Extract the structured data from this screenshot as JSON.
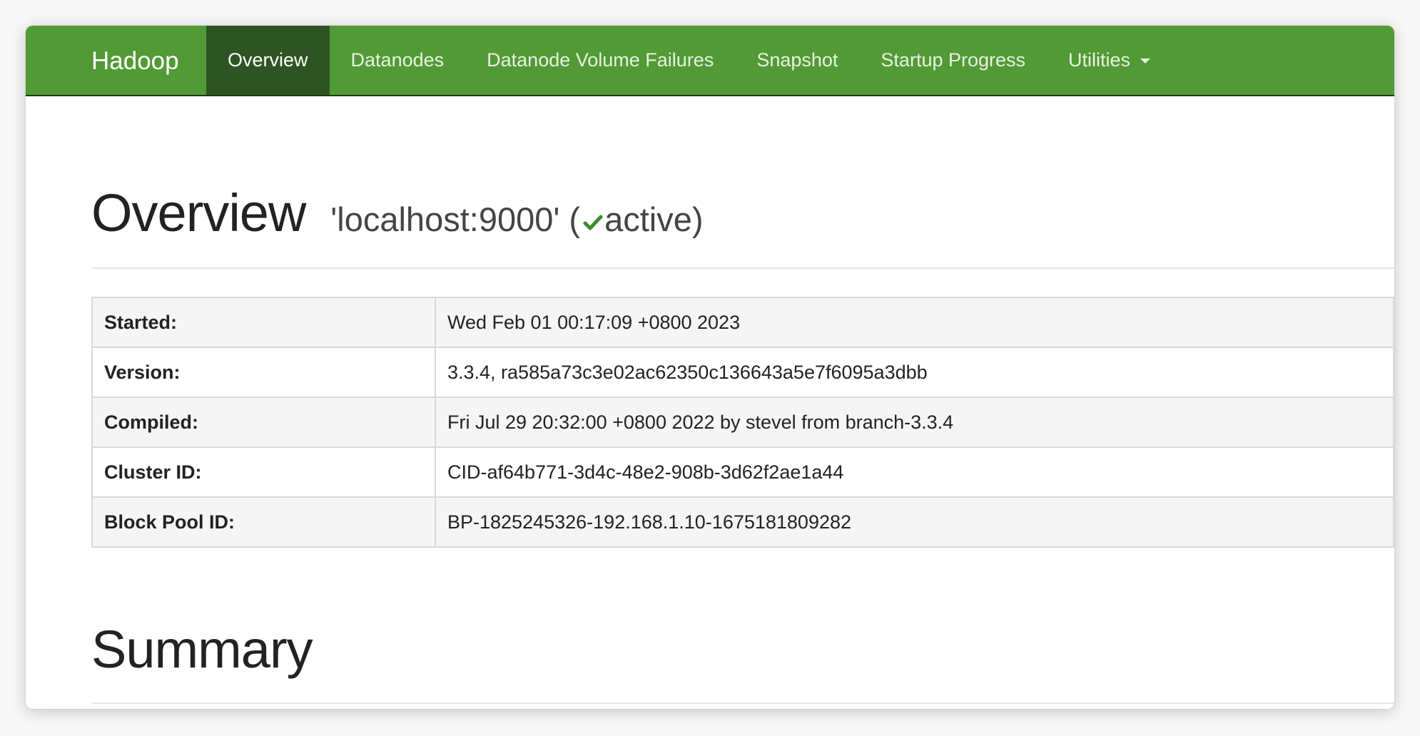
{
  "navbar": {
    "brand": "Hadoop",
    "items": [
      {
        "label": "Overview",
        "active": true
      },
      {
        "label": "Datanodes",
        "active": false
      },
      {
        "label": "Datanode Volume Failures",
        "active": false
      },
      {
        "label": "Snapshot",
        "active": false
      },
      {
        "label": "Startup Progress",
        "active": false
      },
      {
        "label": "Utilities",
        "active": false,
        "dropdown": true
      }
    ]
  },
  "overview": {
    "title": "Overview",
    "host": "'localhost:9000'",
    "paren_open": "(",
    "status_icon": "check-icon",
    "status": "active",
    "paren_close": ")"
  },
  "info": {
    "rows": [
      {
        "label": "Started:",
        "value": "Wed Feb 01 00:17:09 +0800 2023"
      },
      {
        "label": "Version:",
        "value": "3.3.4, ra585a73c3e02ac62350c136643a5e7f6095a3dbb"
      },
      {
        "label": "Compiled:",
        "value": "Fri Jul 29 20:32:00 +0800 2022 by stevel from branch-3.3.4"
      },
      {
        "label": "Cluster ID:",
        "value": "CID-af64b771-3d4c-48e2-908b-3d62f2ae1a44"
      },
      {
        "label": "Block Pool ID:",
        "value": "BP-1825245326-192.168.1.10-1675181809282"
      }
    ]
  },
  "summary": {
    "title": "Summary"
  },
  "colors": {
    "navbar_bg": "#529a36",
    "navbar_active_bg": "#2f5423",
    "status_check": "#3c8a2b"
  }
}
